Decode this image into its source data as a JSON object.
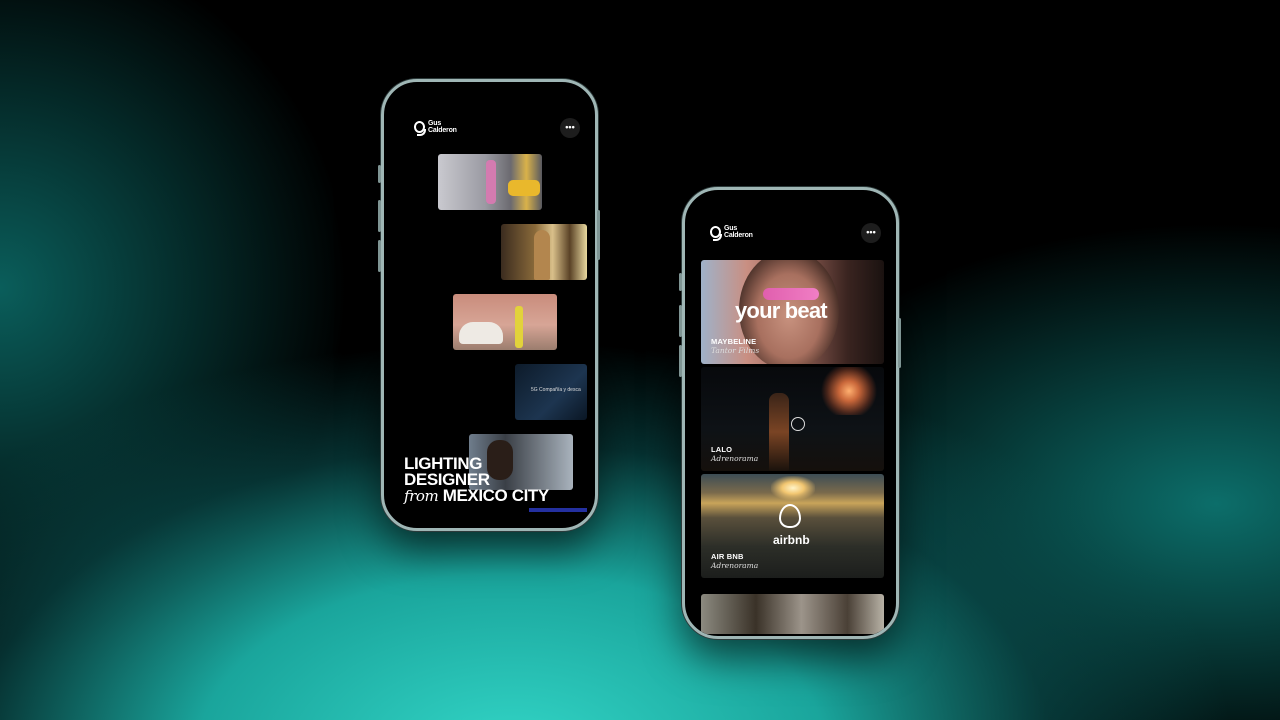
{
  "phone_left": {
    "logo": {
      "line1": "Gus",
      "line2": "Calderon"
    },
    "menu_icon": "more-horizontal-icon",
    "menu_label": "•••",
    "thumb_caption": "5G Compañía y desca",
    "headline": {
      "line1": "LIGHTING",
      "line2": "DESIGNER",
      "from": "from",
      "line3": "MEXICO CITY"
    }
  },
  "phone_right": {
    "logo": {
      "line1": "Gus",
      "line2": "Calderon"
    },
    "menu_label": "•••",
    "projects": [
      {
        "client": "MAYBELINE",
        "studio": "Tantor Films",
        "overlay": "your beat"
      },
      {
        "client": "LALO",
        "studio": "Adrenorama"
      },
      {
        "client": "AIR BNB",
        "studio": "Adrenorama",
        "brand": "airbnb"
      }
    ]
  },
  "colors": {
    "accent": "#2fd4c6",
    "screen_bg": "#000000",
    "frame": "#9fb6b5"
  }
}
